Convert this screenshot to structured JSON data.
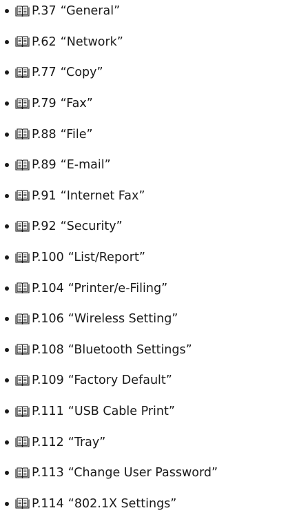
{
  "references": [
    {
      "page": "P.37",
      "title": "“General”"
    },
    {
      "page": "P.62",
      "title": "“Network”"
    },
    {
      "page": "P.77",
      "title": "“Copy”"
    },
    {
      "page": "P.79",
      "title": "“Fax”"
    },
    {
      "page": "P.88",
      "title": "“File”"
    },
    {
      "page": "P.89",
      "title": "“E-mail”"
    },
    {
      "page": "P.91",
      "title": "“Internet Fax”"
    },
    {
      "page": "P.92",
      "title": "“Security”"
    },
    {
      "page": "P.100",
      "title": "“List/Report”"
    },
    {
      "page": "P.104",
      "title": "“Printer/e-Filing”"
    },
    {
      "page": "P.106",
      "title": "“Wireless Setting”"
    },
    {
      "page": "P.108",
      "title": "“Bluetooth Settings”"
    },
    {
      "page": "P.109",
      "title": "“Factory Default”"
    },
    {
      "page": "P.111",
      "title": "“USB Cable Print”"
    },
    {
      "page": "P.112",
      "title": "“Tray”"
    },
    {
      "page": "P.113",
      "title": "“Change User Password”"
    },
    {
      "page": "P.114",
      "title": "“802.1X Settings”"
    }
  ],
  "icon": "book-icon"
}
